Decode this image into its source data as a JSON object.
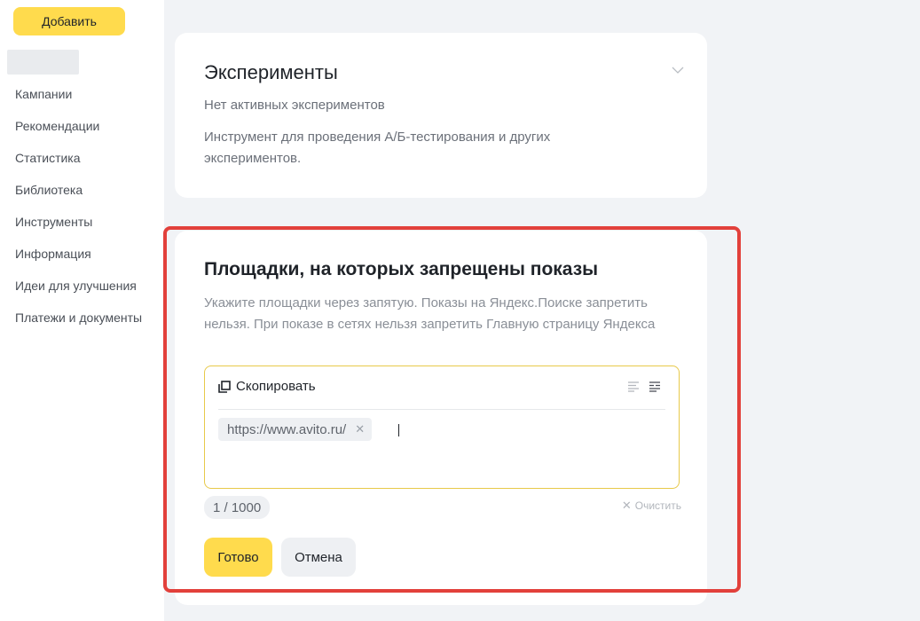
{
  "sidebar": {
    "add_button": "Добавить",
    "items": [
      {
        "label": "Кампании"
      },
      {
        "label": "Рекомендации"
      },
      {
        "label": "Статистика"
      },
      {
        "label": "Библиотека"
      },
      {
        "label": "Инструменты"
      },
      {
        "label": "Информация"
      },
      {
        "label": "Идеи для улучшения"
      },
      {
        "label": "Платежи и документы"
      }
    ]
  },
  "experiments": {
    "title": "Эксперименты",
    "status": "Нет активных экспериментов",
    "description": "Инструмент для проведения А/Б-тестирования и других экспериментов."
  },
  "sites": {
    "title": "Площадки, на которых запрещены показы",
    "description": "Укажите площадки через запятую. Показы на Яндекс.Поиске запретить нельзя. При показе в сетях нельзя запретить Главную страницу Яндекса",
    "copy_label": "Скопировать",
    "tags": [
      "https://www.avito.ru/"
    ],
    "counter": "1 / 1000",
    "clear_label": "Очистить",
    "done_button": "Готово",
    "cancel_button": "Отмена"
  },
  "colors": {
    "accent_yellow": "#ffdb4d",
    "highlight_red": "#e2403b"
  }
}
